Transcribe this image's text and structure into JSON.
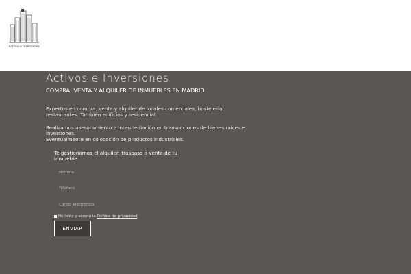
{
  "header": {
    "logo_text": "Activos e Inversiones"
  },
  "main": {
    "title": "Activos e Inversiones",
    "subtitle": "COMPRA, VENTA Y ALQUILER DE INMUEBLES EN MADRID",
    "paragraph1": "Expertos en compra, venta y alquiler de locales comerciales, hostelería, restaurantes. También edificios y residencial.",
    "paragraph2_line1": "Realizamos asesoramiento e Intermediación en transacciones de bienes raíces e inversiones.",
    "paragraph2_line2": "Eventualmente en colocación de productos industriales."
  },
  "form": {
    "title": "Te gestionamos el alquiler, traspaso o venta de tu inmueble",
    "name_placeholder": "Nombre",
    "phone_placeholder": "Teléfono",
    "email_placeholder": "Correo electrónico",
    "consent_text": "He leído y acepto la",
    "privacy_link": "Política de privacidad",
    "submit_label": "ENVIAR"
  },
  "colors": {
    "main_background": "#5a5655",
    "button_background": "#3d3a39"
  }
}
